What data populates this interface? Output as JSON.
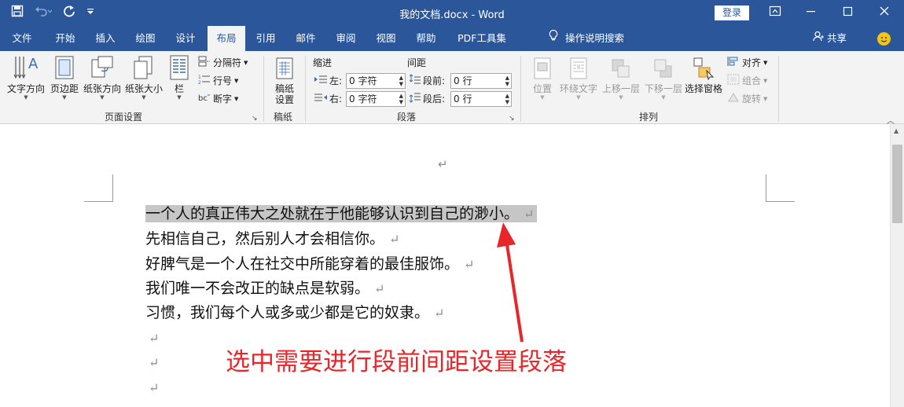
{
  "window": {
    "title": "我的文档.docx  -  Word",
    "login_label": "登录"
  },
  "tabs": [
    "文件",
    "开始",
    "插入",
    "绘图",
    "设计",
    "布局",
    "引用",
    "邮件",
    "审阅",
    "视图",
    "帮助",
    "PDF工具集"
  ],
  "active_tab": "布局",
  "tell_me": "操作说明搜索",
  "share_label": "共享",
  "page_setup": {
    "group_label": "页面设置",
    "text_direction": "文字方向",
    "margins": "页边距",
    "orientation": "纸张方向",
    "size": "纸张大小",
    "columns": "栏",
    "breaks": "分隔符",
    "line_numbers": "行号",
    "hyphenation": "断字"
  },
  "manuscript": {
    "group_label": "稿纸",
    "button_line1": "稿纸",
    "button_line2": "设置"
  },
  "paragraph": {
    "group_label": "段落",
    "indent_header": "缩进",
    "spacing_header": "间距",
    "left_label": "左:",
    "left_value": "0 字符",
    "right_label": "右:",
    "right_value": "0 字符",
    "before_label": "段前:",
    "before_value": "0 行",
    "after_label": "段后:",
    "after_value": "0 行"
  },
  "arrange": {
    "group_label": "排列",
    "position": "位置",
    "wrap_text": "环绕文字",
    "bring_forward": "上移一层",
    "send_backward": "下移一层",
    "selection_pane": "选择窗格",
    "align": "对齐",
    "group": "组合",
    "rotate": "旋转"
  },
  "document": {
    "lines": [
      "一个人的真正伟大之处就在于他能够认识到自己的渺小。",
      "先相信自己，然后别人才会相信你。",
      "好脾气是一个人在社交中所能穿着的最佳服饰。",
      "我们唯一不会改正的缺点是软弱。",
      "习惯，我们每个人或多或少都是它的奴隶。"
    ],
    "paragraph_mark": "↵"
  },
  "annotation": {
    "text": "选中需要进行段前间距设置段落",
    "color": "#e8262a"
  },
  "colors": {
    "title_bar": "#2b579a",
    "ribbon": "#f3f3f3",
    "selection": "#c6c6c6"
  }
}
